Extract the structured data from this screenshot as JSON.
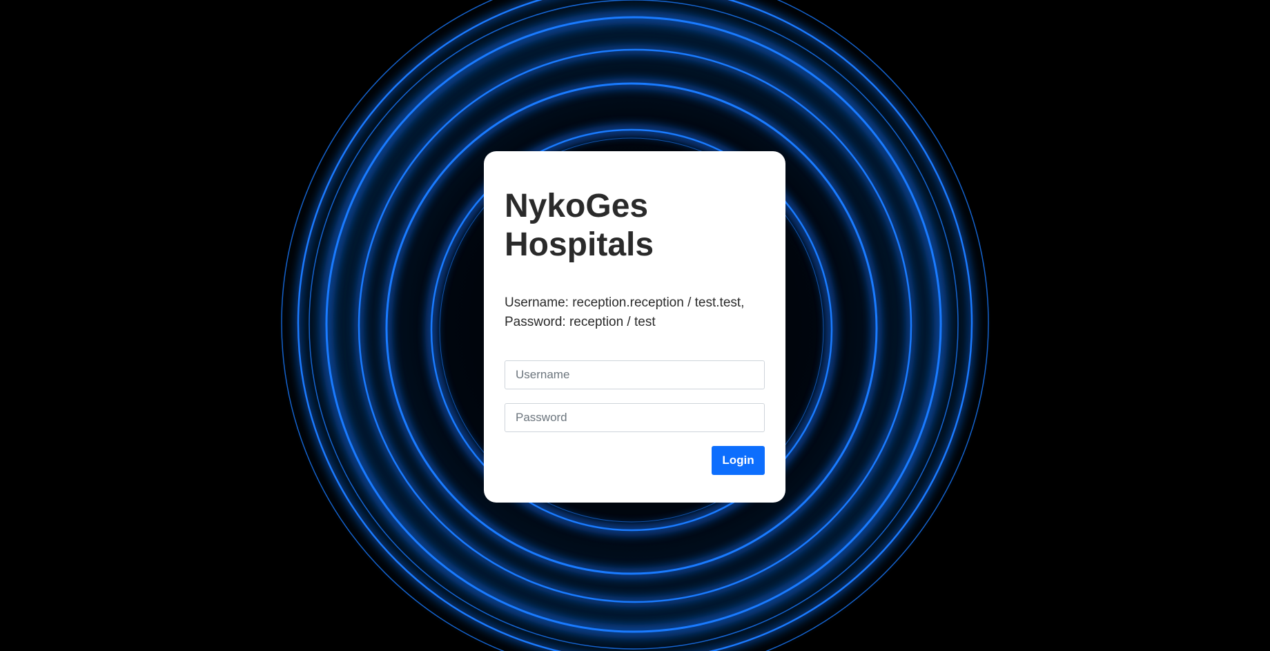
{
  "app": {
    "title_line1": "NykoGes",
    "title_line2": "Hospitals"
  },
  "credentials": {
    "line1": "Username: reception.reception / test.test,",
    "line2": "Password: reception / test"
  },
  "form": {
    "username_placeholder": "Username",
    "username_value": "",
    "password_placeholder": "Password",
    "password_value": "",
    "login_label": "Login"
  },
  "colors": {
    "background": "#000000",
    "ring_blue": "#1a7bff",
    "card": "#ffffff",
    "button": "#0d6efd",
    "text": "#2a2a2a"
  }
}
